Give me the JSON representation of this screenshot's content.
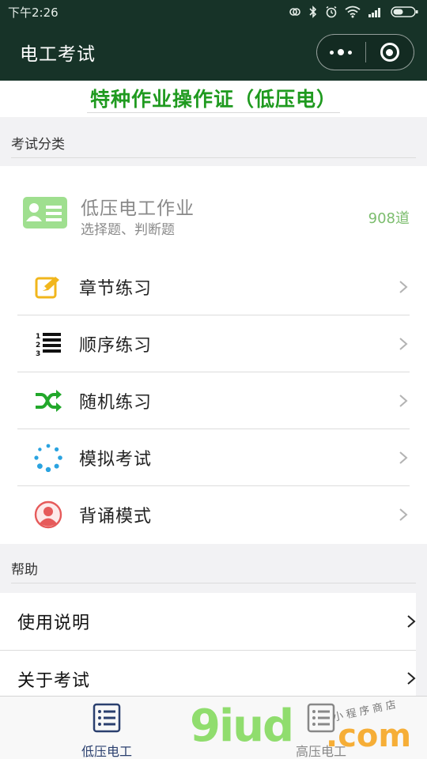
{
  "status_bar": {
    "time": "下午2:26",
    "icons": [
      "sync-icon",
      "bluetooth-icon",
      "alarm-icon",
      "wifi-icon",
      "signal-icon",
      "battery-icon"
    ]
  },
  "nav": {
    "title": "电工考试",
    "capsule_icons": [
      "more-dots-icon",
      "close-target-icon"
    ]
  },
  "banner": {
    "title": "特种作业操作证（低压电）"
  },
  "categories_section": {
    "label": "考试分类",
    "category": {
      "name": "低压电工作业",
      "subtitle": "选择题、判断题",
      "count": "908道",
      "icon": "id-card-icon"
    },
    "items": [
      {
        "label": "章节练习",
        "icon": "edit-icon"
      },
      {
        "label": "顺序练习",
        "icon": "ordered-list-icon"
      },
      {
        "label": "随机练习",
        "icon": "shuffle-icon"
      },
      {
        "label": "模拟考试",
        "icon": "loading-dots-icon"
      },
      {
        "label": "背诵模式",
        "icon": "user-avatar-icon"
      }
    ]
  },
  "help_section": {
    "label": "帮助",
    "items": [
      {
        "label": "使用说明"
      },
      {
        "label": "关于考试"
      }
    ]
  },
  "tab_bar": {
    "tabs": [
      {
        "label": "低压电工",
        "icon": "list-icon",
        "active": true
      },
      {
        "label": "高压电工",
        "icon": "list-icon",
        "active": false
      }
    ]
  },
  "watermark": {
    "brand": "9iud",
    "domain": ".com",
    "tagline": "小程序商店"
  },
  "colors": {
    "nav_bg": "#173328",
    "banner_green": "#1f9a1f",
    "count_green": "#7cbd6e",
    "active_tab": "#2a3f6e"
  }
}
